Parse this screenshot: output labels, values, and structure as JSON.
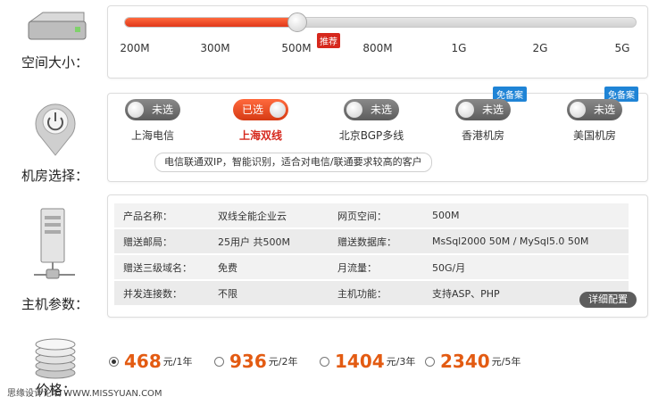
{
  "rows": {
    "space_label": "空间大小：",
    "room_label": "机房选择：",
    "params_label": "主机参数：",
    "price_label": "价格："
  },
  "space": {
    "ticks": [
      "200M",
      "300M",
      "500M",
      "800M",
      "1G",
      "2G",
      "5G"
    ],
    "selected_index": 2,
    "recommend_badge": "推荐"
  },
  "rooms": {
    "items": [
      {
        "toggle": "未选",
        "name": "上海电信",
        "selected": false,
        "badge": ""
      },
      {
        "toggle": "已选",
        "name": "上海双线",
        "selected": true,
        "badge": ""
      },
      {
        "toggle": "未选",
        "name": "北京BGP多线",
        "selected": false,
        "badge": ""
      },
      {
        "toggle": "未选",
        "name": "香港机房",
        "selected": false,
        "badge": "免备案"
      },
      {
        "toggle": "未选",
        "name": "美国机房",
        "selected": false,
        "badge": "免备案"
      }
    ],
    "hint": "电信联通双IP，智能识别，适合对电信/联通要求较高的客户"
  },
  "params": {
    "rows": [
      [
        "产品名称：",
        "双线全能企业云",
        "网页空间：",
        "500M"
      ],
      [
        "赠送邮局：",
        "25用户 共500M",
        "赠送数据库：",
        "MsSql2000 50M / MySql5.0 50M"
      ],
      [
        "赠送三级域名：",
        "免费",
        "月流量：",
        "50G/月"
      ],
      [
        "并发连接数：",
        "不限",
        "主机功能：",
        "支持ASP、PHP"
      ]
    ],
    "detail_button": "详细配置"
  },
  "price": {
    "options": [
      {
        "amount": "468",
        "unit": "元/1年",
        "checked": true
      },
      {
        "amount": "936",
        "unit": "元/2年",
        "checked": false
      },
      {
        "amount": "1404",
        "unit": "元/3年",
        "checked": false
      },
      {
        "amount": "2340",
        "unit": "元/5年",
        "checked": false
      }
    ]
  },
  "watermark": "思缘设计论坛 WWW.MISSYUAN.COM",
  "colors": {
    "accent": "#e35b12",
    "badge_red": "#d6281d",
    "badge_blue": "#1f84d6"
  }
}
